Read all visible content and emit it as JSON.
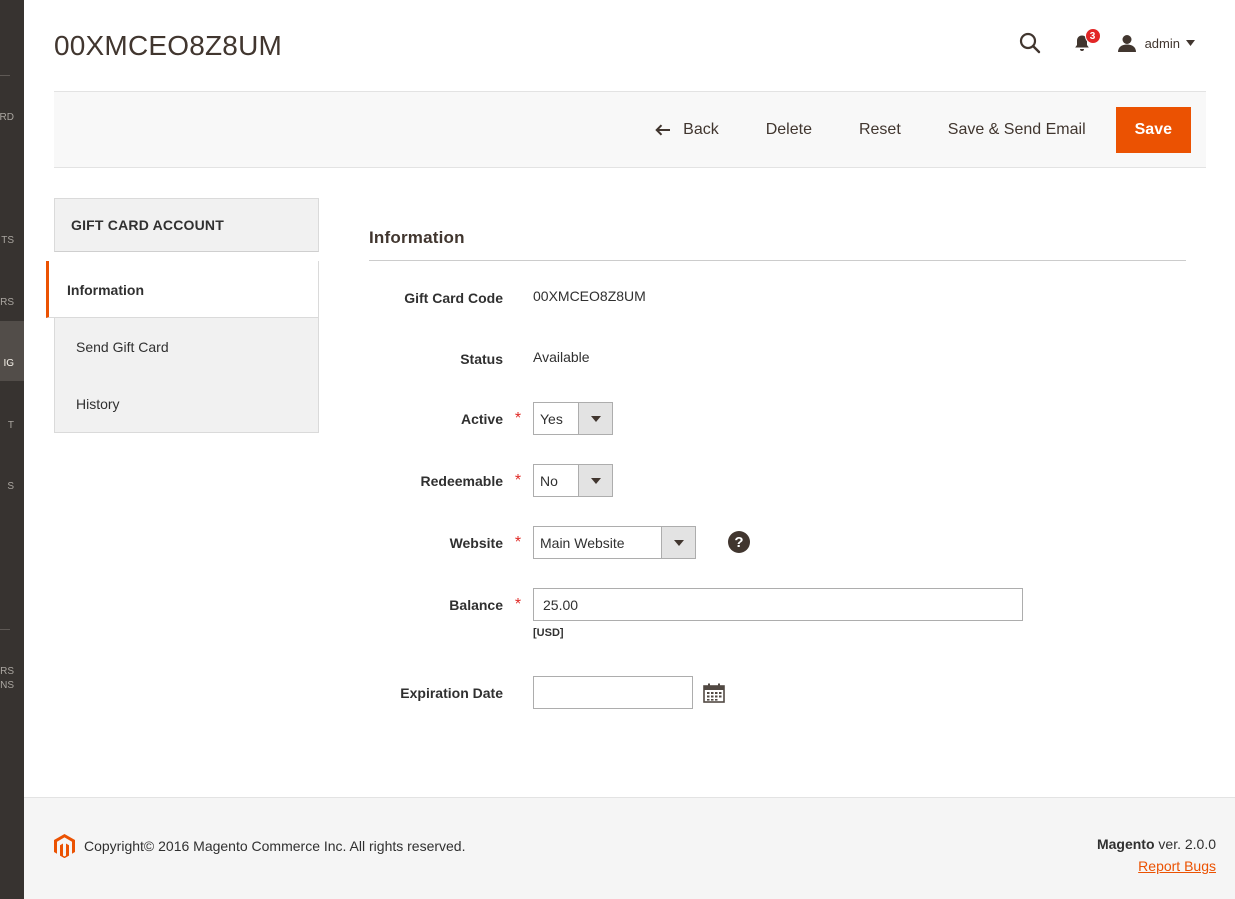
{
  "nav": {
    "fragments": [
      "RD",
      "TS",
      "RS",
      "IG",
      "T",
      "S",
      "ERS",
      "IONS"
    ]
  },
  "header": {
    "title": "00XMCEO8Z8UM",
    "notification_count": "3",
    "user_label": "admin"
  },
  "actions": {
    "back": "Back",
    "delete": "Delete",
    "reset": "Reset",
    "save_send": "Save & Send Email",
    "save": "Save"
  },
  "sidebar": {
    "heading": "GIFT CARD ACCOUNT",
    "items": [
      {
        "label": "Information"
      },
      {
        "label": "Send Gift Card"
      },
      {
        "label": "History"
      }
    ]
  },
  "form": {
    "legend": "Information",
    "gift_card_code": {
      "label": "Gift Card Code",
      "value": "00XMCEO8Z8UM"
    },
    "status": {
      "label": "Status",
      "value": "Available"
    },
    "active": {
      "label": "Active",
      "value": "Yes"
    },
    "redeemable": {
      "label": "Redeemable",
      "value": "No"
    },
    "website": {
      "label": "Website",
      "value": "Main Website",
      "help": "?"
    },
    "balance": {
      "label": "Balance",
      "value": "25.00",
      "currency": "[USD]"
    },
    "expiration": {
      "label": "Expiration Date",
      "value": "",
      "placeholder": ""
    },
    "required_mark": "*"
  },
  "footer": {
    "copyright": "Copyright© 2016 Magento Commerce Inc. All rights reserved.",
    "brand": "Magento",
    "version": " ver. 2.0.0",
    "report": "Report Bugs"
  },
  "colors": {
    "accent": "#eb5202",
    "nav_bg": "#373330",
    "required": "#e02b27"
  }
}
